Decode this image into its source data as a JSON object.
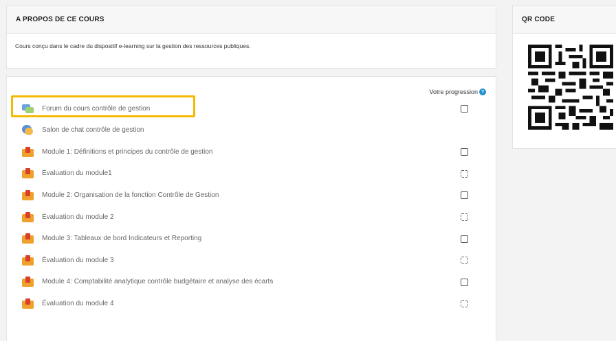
{
  "about": {
    "title": "A PROPOS DE CE COURS",
    "description": "Cours conçu dans le cadre du dispositif e-learning sur la gestion des ressources publiques."
  },
  "qr": {
    "title": "QR CODE"
  },
  "progress": {
    "label": "Votre progression",
    "help": "?"
  },
  "activities": [
    {
      "label": "Forum du cours contrôle de gestion",
      "icon": "forum-icon",
      "checkbox": "manual"
    },
    {
      "label": "Salon de chat contrôle de gestion",
      "icon": "chat-icon",
      "checkbox": "none"
    },
    {
      "label": "Module 1: Définitions et principes du contrôle de gestion",
      "icon": "module-icon",
      "checkbox": "manual"
    },
    {
      "label": "Évaluation du module1",
      "icon": "module-icon",
      "checkbox": "auto"
    },
    {
      "label": "Module 2: Organisation de la fonction Contrôle de Gestion",
      "icon": "module-icon",
      "checkbox": "manual"
    },
    {
      "label": "Évaluation du module 2",
      "icon": "module-icon",
      "checkbox": "auto"
    },
    {
      "label": "Module 3: Tableaux de bord Indicateurs et Reporting",
      "icon": "module-icon",
      "checkbox": "manual"
    },
    {
      "label": "Évaluation du module 3",
      "icon": "module-icon",
      "checkbox": "auto"
    },
    {
      "label": "Module 4: Comptabilité analytique contrôle budgétaire et analyse des écarts",
      "icon": "module-icon",
      "checkbox": "manual"
    },
    {
      "label": "Évaluation du module 4",
      "icon": "module-icon",
      "checkbox": "auto"
    }
  ],
  "colors": {
    "highlight": "#f5b800",
    "help": "#1f8fcf"
  }
}
